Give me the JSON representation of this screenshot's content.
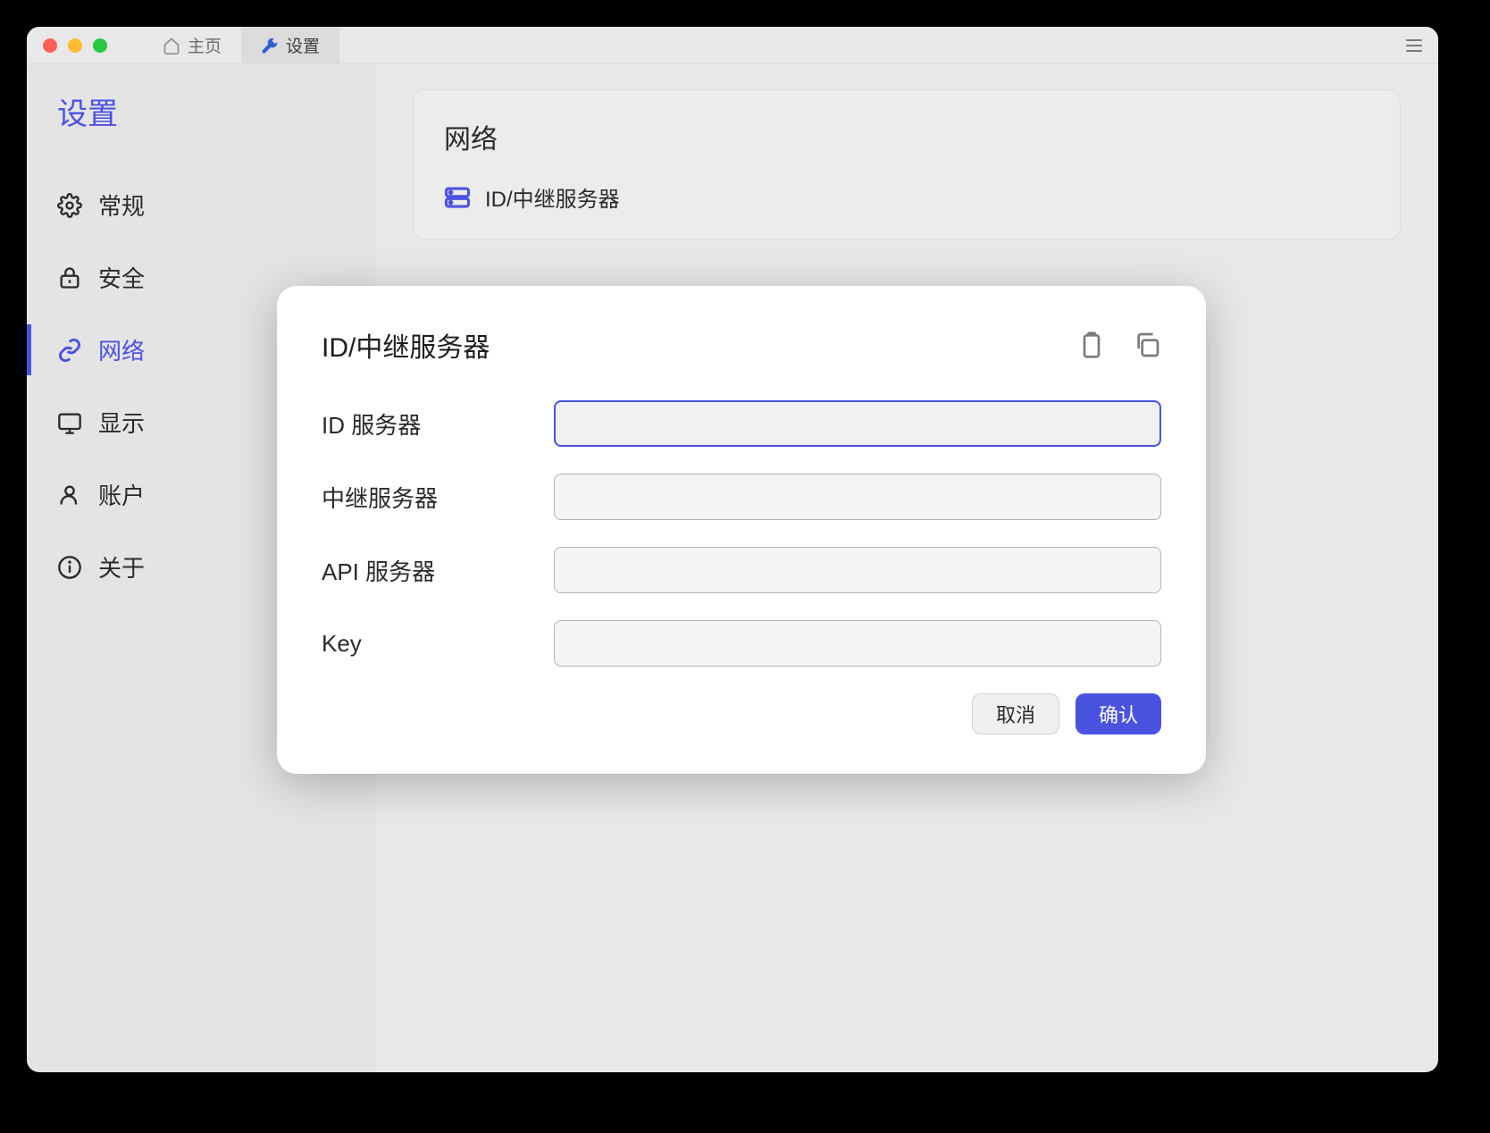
{
  "titlebar": {
    "tabs": {
      "home": "主页",
      "settings": "设置"
    }
  },
  "sidebar": {
    "title": "设置",
    "items": {
      "general": "常规",
      "security": "安全",
      "network": "网络",
      "display": "显示",
      "account": "账户",
      "about": "关于"
    }
  },
  "section": {
    "title": "网络",
    "row1": "ID/中继服务器"
  },
  "dialog": {
    "title": "ID/中继服务器",
    "fields": {
      "id_server": {
        "label": "ID 服务器",
        "value": ""
      },
      "relay_server": {
        "label": "中继服务器",
        "value": ""
      },
      "api_server": {
        "label": "API 服务器",
        "value": ""
      },
      "key": {
        "label": "Key",
        "value": ""
      }
    },
    "buttons": {
      "cancel": "取消",
      "confirm": "确认"
    }
  },
  "colors": {
    "accent": "#4a52e0"
  }
}
